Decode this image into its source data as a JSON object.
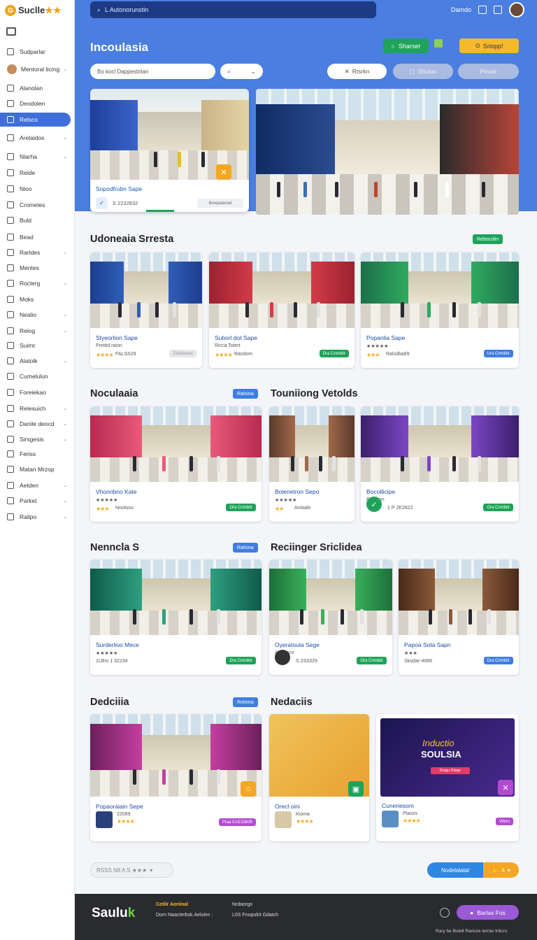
{
  "brand": {
    "name": "Suclle",
    "name_accent": "★★",
    "logo_glyph": "G"
  },
  "sidebar": {
    "items": [
      {
        "label": "Sudparlar",
        "chevron": false
      },
      {
        "label": "Mentoral ticing",
        "chevron": true,
        "avatar": true
      },
      {
        "label": "Alanolan",
        "chevron": false
      },
      {
        "label": "Deodolen",
        "chevron": false
      },
      {
        "label": "Relsco",
        "chevron": false,
        "active": true
      },
      {
        "label": "Arelaidos",
        "chevron": true
      },
      {
        "label": "Nlarha",
        "chevron": true
      },
      {
        "label": "Reide",
        "chevron": false
      },
      {
        "label": "Nloo",
        "chevron": false
      },
      {
        "label": "Cromeles",
        "chevron": false
      },
      {
        "label": "Buld",
        "chevron": false
      },
      {
        "label": "Bead",
        "chevron": false
      },
      {
        "label": "Rarldes",
        "chevron": true
      },
      {
        "label": "Mentes",
        "chevron": false
      },
      {
        "label": "Roclerg",
        "chevron": true
      },
      {
        "label": "Moks",
        "chevron": false
      },
      {
        "label": "Nealio",
        "chevron": true
      },
      {
        "label": "Relog",
        "chevron": true
      },
      {
        "label": "Suimt",
        "chevron": false
      },
      {
        "label": "Alatolk",
        "chevron": true
      },
      {
        "label": "Cumelulun",
        "chevron": false
      },
      {
        "label": "Foreiekao",
        "chevron": false
      },
      {
        "label": "Relesuich",
        "chevron": true
      },
      {
        "label": "Danile deocd",
        "chevron": true
      },
      {
        "label": "Sirsgesis",
        "chevron": true
      },
      {
        "label": "Feriss",
        "chevron": false
      },
      {
        "label": "Matan Mrzop",
        "chevron": false
      },
      {
        "label": "Aetden",
        "chevron": true
      },
      {
        "label": "Parket",
        "chevron": true
      },
      {
        "label": "Railpo",
        "chevron": true
      }
    ]
  },
  "header": {
    "search_value": "L Autonorunstin",
    "user_label": "Damdo",
    "page_title": "Incoulasia",
    "btn_green": "Sharser",
    "btn_yellow": "Sriopp!",
    "filter_input": "Bo kocl Dappestnlan",
    "filter_select_icon": "search-icon",
    "pills": [
      "Rtsrkn",
      "Shuloo",
      "Pinule"
    ]
  },
  "hero_card": {
    "title": "Sopodfrubn Sape",
    "code": "S 2232832",
    "action": "Iboxpatanad"
  },
  "sections": [
    {
      "title": "Udoneaia Srresta",
      "badge": "Rebocolin"
    },
    {
      "title": "Noculaaia",
      "badge": "Ralnina"
    },
    {
      "title": "Touniiong Vetolds",
      "badge": ""
    },
    {
      "title": "Nenncla S",
      "badge": "Ralnina"
    },
    {
      "title": "Reciinger Sriclidea",
      "badge": ""
    },
    {
      "title": "Dedciiia",
      "badge": "Rolnina"
    },
    {
      "title": "Nedaciis",
      "badge": ""
    }
  ],
  "cards": [
    {
      "title": "Styeorlion Sape",
      "sub": "Predol raion",
      "stars": "★★★★",
      "meta": "FALSS29",
      "btn": "Dabbastes"
    },
    {
      "title": "Suborl dot Sape",
      "sub": "Ricca Toiert",
      "stars": "★★★★",
      "meta": "Rasdom",
      "btn": "Dra Cnmbtir"
    },
    {
      "title": "Popanlia Sape",
      "sub": "★★★★★",
      "stars": "★★★",
      "meta": "Ralsdba89",
      "btn": "Ura Cnmbtir"
    },
    {
      "title": "Vhonribno Kate",
      "sub": "★★★★★",
      "stars": "★★★",
      "meta": "Nootsso",
      "btn": "Ora Cnmbtir"
    },
    {
      "title": "Bolenetron Sepo",
      "sub": "★★★★★",
      "stars": "★★",
      "meta": "Anlaale",
      "btn": ""
    },
    {
      "title": "Bocotlicipe",
      "sub": "Ralnson",
      "stars": "",
      "meta": "1 P 2E2822",
      "btn": "Ora Cnmbtir"
    },
    {
      "title": "Surderlioo Mece",
      "sub": "★★★★★",
      "stars": "",
      "meta": "1LBm 1 32234",
      "btn": "Dra Crenbtir"
    },
    {
      "title": "Oyeratoula Sege",
      "sub": "Arsidoco",
      "stars": "",
      "meta": "S 2S3329",
      "btn": "Ora Cnmbtir"
    },
    {
      "title": "Papoa Sota Sapn",
      "sub": "★★★",
      "stars": "",
      "meta": "Skodar-4086",
      "btn": "Dra Cnmbtir"
    },
    {
      "title": "Popaoraiain Sepe",
      "sub": "22099",
      "stars": "★★★★",
      "meta": "",
      "btn": "Praa EAE33835"
    },
    {
      "title": "Orecl oini",
      "sub": "Kioma",
      "stars": "★★★★",
      "meta": "",
      "btn": ""
    },
    {
      "title": "Cuneriesom",
      "sub": "Ptasxs",
      "stars": "★★★★",
      "meta": "",
      "btn": "Vllors"
    }
  ],
  "promo": {
    "line1": "Inductio",
    "line2": "SOULSIA",
    "btn": "Bolgu Dlaqe"
  },
  "pager": {
    "label": "RSSS N8 A S ★★★"
  },
  "cta": {
    "left": "Nodelalatal",
    "right": "4"
  },
  "footer": {
    "logo": "Saulu",
    "logo_accent": "k",
    "line1_bold": "Cotilr Aoriinal",
    "line1_mid": "Nrdaorgo",
    "line2": "Dorn Naacterbsk.Aeloiim :",
    "line2_mid": "L0S Fnopolrit Gdatch",
    "button": "Barlas Fos",
    "copyright": "Rary be Bolell Rarioze terrier trikcrs"
  }
}
